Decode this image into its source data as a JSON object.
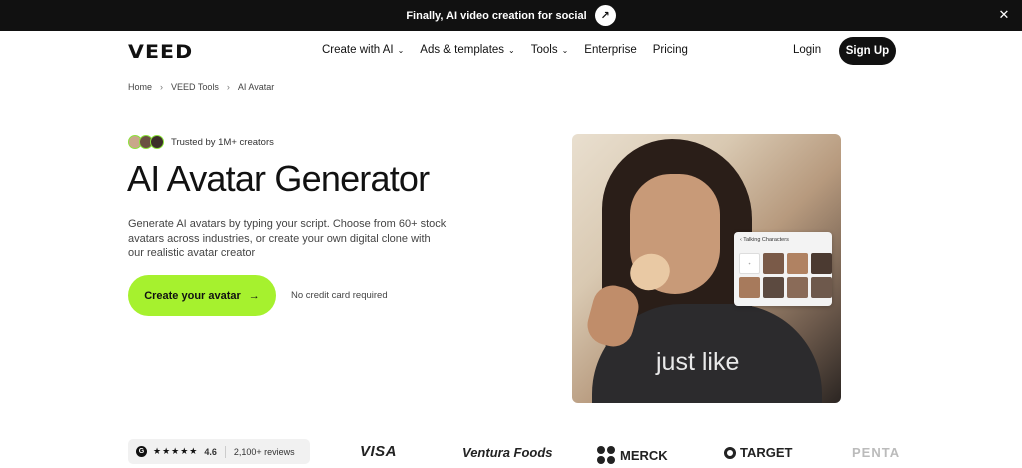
{
  "announcement": {
    "text": "Finally, AI video creation for social",
    "arrow_icon": "arrow-up-right-icon",
    "close_icon": "close-icon"
  },
  "header": {
    "logo": "VEED",
    "nav": [
      {
        "label": "Create with AI",
        "has_dropdown": true
      },
      {
        "label": "Ads & templates",
        "has_dropdown": true
      },
      {
        "label": "Tools",
        "has_dropdown": true
      },
      {
        "label": "Enterprise",
        "has_dropdown": false
      },
      {
        "label": "Pricing",
        "has_dropdown": false
      }
    ],
    "login": "Login",
    "signup": "Sign Up"
  },
  "breadcrumb": [
    "Home",
    "VEED Tools",
    "AI Avatar"
  ],
  "hero": {
    "trusted_text": "Trusted by 1M+ creators",
    "title": "AI Avatar Generator",
    "description": "Generate AI avatars by typing your script. Choose from 60+ stock avatars across industries, or create your own digital clone with our realistic avatar creator",
    "cta_label": "Create your avatar",
    "cta_arrow": "→",
    "no_credit_text": "No credit card required",
    "video_caption": "just like",
    "panel_title": "Talking Characters"
  },
  "social_proof": {
    "rating": "4.6",
    "stars": "★★★★★",
    "reviews": "2,100+ reviews",
    "logos": [
      "VISA",
      "Ventura Foods",
      "MERCK",
      "TARGET",
      "PENTA"
    ]
  },
  "colors": {
    "accent": "#a6f12e",
    "dark": "#111111"
  }
}
